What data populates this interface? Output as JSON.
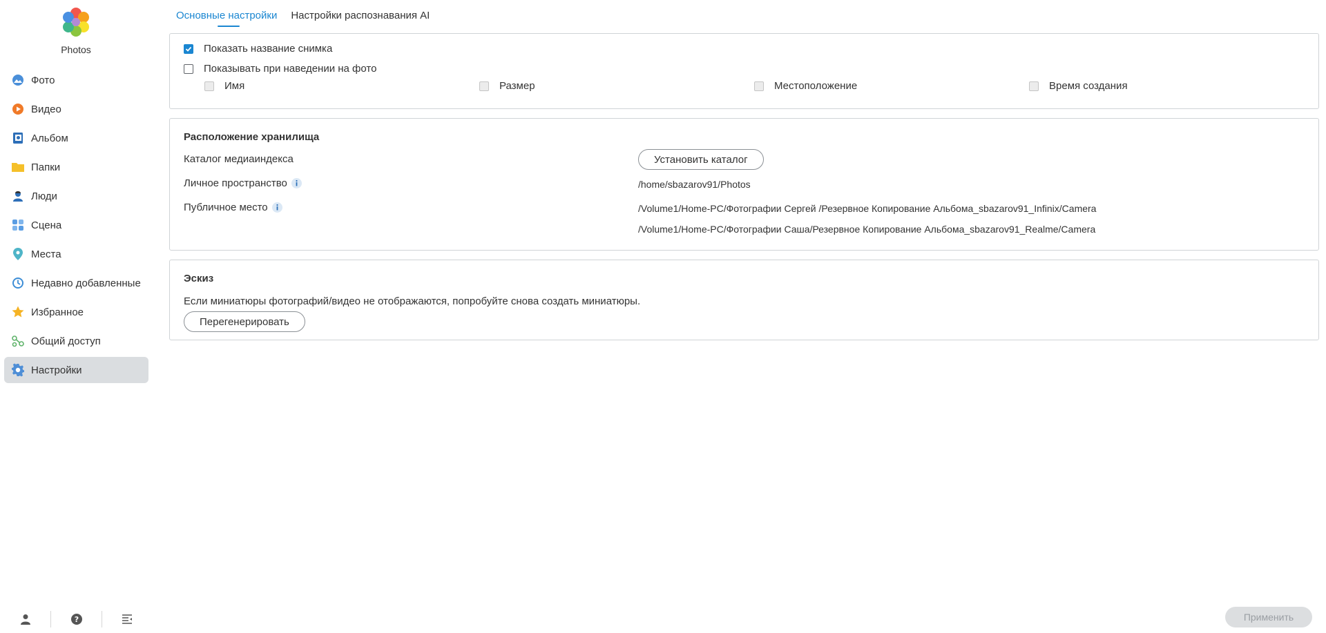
{
  "app": {
    "name": "Photos"
  },
  "sidebar": {
    "items": [
      {
        "label": "Фото",
        "icon": "photo-icon"
      },
      {
        "label": "Видео",
        "icon": "video-icon"
      },
      {
        "label": "Альбом",
        "icon": "album-icon"
      },
      {
        "label": "Папки",
        "icon": "folder-icon"
      },
      {
        "label": "Люди",
        "icon": "person-icon"
      },
      {
        "label": "Сцена",
        "icon": "scene-icon"
      },
      {
        "label": "Места",
        "icon": "location-pin-icon"
      },
      {
        "label": "Недавно добавленные",
        "icon": "clock-icon"
      },
      {
        "label": "Избранное",
        "icon": "star-icon"
      },
      {
        "label": "Общий доступ",
        "icon": "share-icon"
      },
      {
        "label": "Настройки",
        "icon": "gear-icon",
        "active": true
      }
    ],
    "bottom": [
      "user-icon",
      "help-icon",
      "collapse-menu-icon"
    ]
  },
  "tabs": [
    {
      "label": "Основные настройки",
      "active": true
    },
    {
      "label": "Настройки распознавания AI",
      "active": false
    }
  ],
  "display": {
    "show_title": {
      "label": "Показать название снимка",
      "checked": true
    },
    "show_on_hover": {
      "label": "Показывать при наведении на фото",
      "checked": false
    },
    "hover_options": [
      {
        "label": "Имя",
        "checked": false
      },
      {
        "label": "Размер",
        "checked": false
      },
      {
        "label": "Местоположение",
        "checked": false
      },
      {
        "label": "Время создания",
        "checked": false
      }
    ]
  },
  "storage": {
    "title": "Расположение хранилища",
    "media_index_label": "Каталог медиаиндекса",
    "set_catalog_button": "Установить каталог",
    "personal_label": "Личное пространство",
    "personal_path": "/home/sbazarov91/Photos",
    "public_label": "Публичное место",
    "public_paths": [
      "/Volume1/Home-PC/Фотографии Сергей /Резервное Копирование Альбома_sbazarov91_Infinix/Camera",
      "/Volume1/Home-PC/Фотографии Саша/Резервное Копирование Альбома_sbazarov91_Realme/Camera"
    ]
  },
  "thumbnail": {
    "title": "Эскиз",
    "description": "Если миниатюры фотографий/видео не отображаются, попробуйте снова создать миниатюры.",
    "regenerate_button": "Перегенерировать"
  },
  "footer": {
    "apply_button": "Применить"
  },
  "colors": {
    "accent": "#1a86d1",
    "active_nav_bg": "#dadde0",
    "panel_border": "#cfd3d6"
  }
}
